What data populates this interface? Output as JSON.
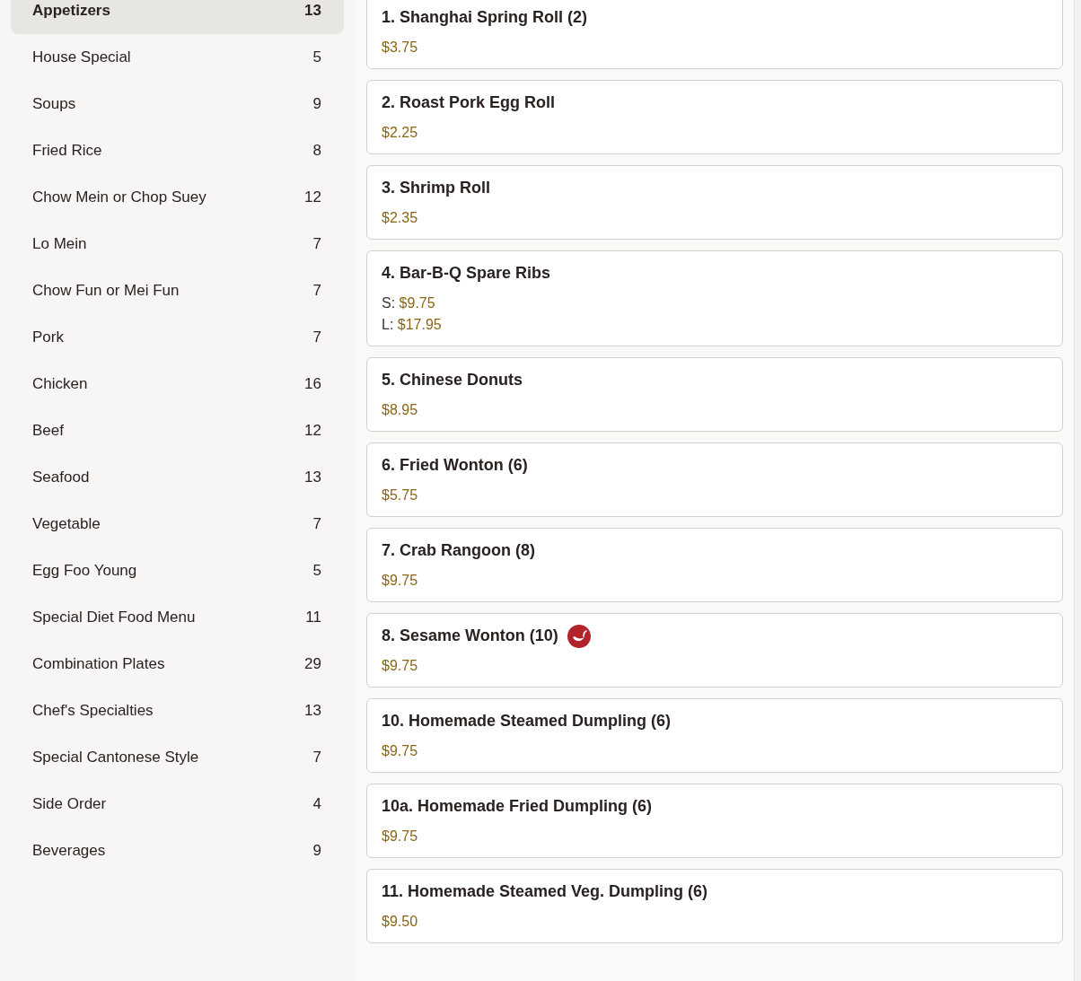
{
  "categories": [
    {
      "label": "Appetizers",
      "count": "13",
      "selected": true
    },
    {
      "label": "House Special",
      "count": "5",
      "selected": false
    },
    {
      "label": "Soups",
      "count": "9",
      "selected": false
    },
    {
      "label": "Fried Rice",
      "count": "8",
      "selected": false
    },
    {
      "label": "Chow Mein or Chop Suey",
      "count": "12",
      "selected": false
    },
    {
      "label": "Lo Mein",
      "count": "7",
      "selected": false
    },
    {
      "label": "Chow Fun or Mei Fun",
      "count": "7",
      "selected": false
    },
    {
      "label": "Pork",
      "count": "7",
      "selected": false
    },
    {
      "label": "Chicken",
      "count": "16",
      "selected": false
    },
    {
      "label": "Beef",
      "count": "12",
      "selected": false
    },
    {
      "label": "Seafood",
      "count": "13",
      "selected": false
    },
    {
      "label": "Vegetable",
      "count": "7",
      "selected": false
    },
    {
      "label": "Egg Foo Young",
      "count": "5",
      "selected": false
    },
    {
      "label": "Special Diet Food Menu",
      "count": "11",
      "selected": false
    },
    {
      "label": "Combination Plates",
      "count": "29",
      "selected": false
    },
    {
      "label": "Chef's Specialties",
      "count": "13",
      "selected": false
    },
    {
      "label": "Special Cantonese Style",
      "count": "7",
      "selected": false
    },
    {
      "label": "Side Order",
      "count": "4",
      "selected": false
    },
    {
      "label": "Beverages",
      "count": "9",
      "selected": false
    }
  ],
  "menu_items": [
    {
      "name": "1. Shanghai Spring Roll (2)",
      "kind": "single",
      "spicy": false,
      "prices": [
        {
          "price": "$3.75"
        }
      ]
    },
    {
      "name": "2. Roast Pork Egg Roll",
      "kind": "single",
      "spicy": false,
      "prices": [
        {
          "price": "$2.25"
        }
      ]
    },
    {
      "name": "3. Shrimp Roll",
      "kind": "single",
      "spicy": false,
      "prices": [
        {
          "price": "$2.35"
        }
      ]
    },
    {
      "name": "4. Bar-B-Q Spare Ribs",
      "kind": "sized",
      "spicy": false,
      "prices": [
        {
          "size": "S:",
          "price": "$9.75"
        },
        {
          "size": "L:",
          "price": "$17.95"
        }
      ]
    },
    {
      "name": "5. Chinese Donuts",
      "kind": "single",
      "spicy": false,
      "prices": [
        {
          "price": "$8.95"
        }
      ]
    },
    {
      "name": "6. Fried Wonton (6)",
      "kind": "single",
      "spicy": false,
      "prices": [
        {
          "price": "$5.75"
        }
      ]
    },
    {
      "name": "7. Crab Rangoon (8)",
      "kind": "single",
      "spicy": false,
      "prices": [
        {
          "price": "$9.75"
        }
      ]
    },
    {
      "name": "8. Sesame Wonton (10)",
      "kind": "single",
      "spicy": true,
      "prices": [
        {
          "price": "$9.75"
        }
      ]
    },
    {
      "name": "10. Homemade Steamed Dumpling (6)",
      "kind": "single",
      "spicy": false,
      "prices": [
        {
          "price": "$9.75"
        }
      ]
    },
    {
      "name": "10a. Homemade Fried Dumpling (6)",
      "kind": "single",
      "spicy": false,
      "prices": [
        {
          "price": "$9.75"
        }
      ]
    },
    {
      "name": "11. Homemade Steamed Veg. Dumpling (6)",
      "kind": "single",
      "spicy": false,
      "prices": [
        {
          "price": "$9.50"
        }
      ]
    }
  ]
}
